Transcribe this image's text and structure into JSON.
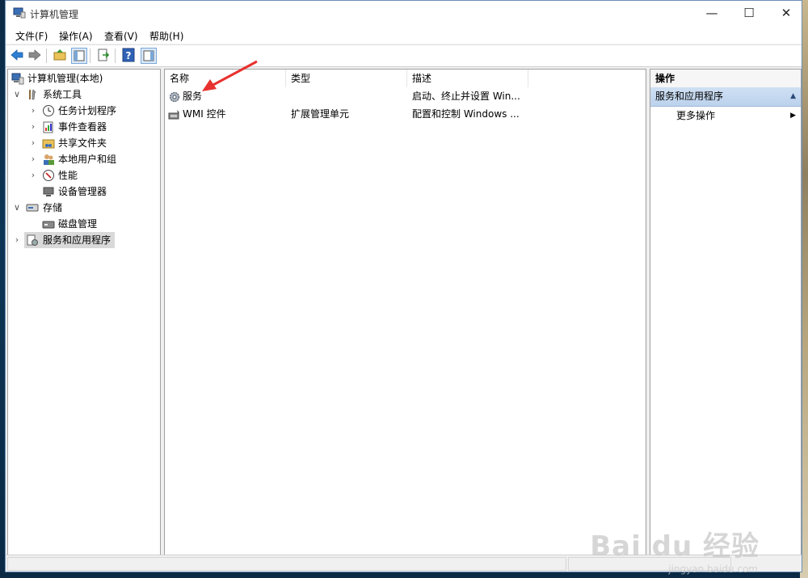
{
  "window": {
    "title": "计算机管理",
    "controls": {
      "minimize": "—",
      "maximize": "☐",
      "close": "✕"
    }
  },
  "menu": [
    "文件(F)",
    "操作(A)",
    "查看(V)",
    "帮助(H)"
  ],
  "tree": {
    "root": "计算机管理(本地)",
    "system_tools": "系统工具",
    "task_scheduler": "任务计划程序",
    "event_viewer": "事件查看器",
    "shared_folders": "共享文件夹",
    "local_users": "本地用户和组",
    "performance": "性能",
    "device_manager": "设备管理器",
    "storage": "存储",
    "disk_management": "磁盘管理",
    "services_apps": "服务和应用程序"
  },
  "list": {
    "columns": [
      "名称",
      "类型",
      "描述"
    ],
    "rows": [
      {
        "name": "服务",
        "type": "",
        "desc": "启动、终止并设置 Win..."
      },
      {
        "name": "WMI 控件",
        "type": "扩展管理单元",
        "desc": "配置和控制 Windows ..."
      }
    ]
  },
  "actions": {
    "header": "操作",
    "section": "服务和应用程序",
    "more": "更多操作"
  },
  "watermark": {
    "main": "Bai du 经验",
    "sub": "jingyan.baidu.com"
  },
  "colors": {
    "annotation_arrow": "#e8322f",
    "selection": "#cce8ff"
  }
}
